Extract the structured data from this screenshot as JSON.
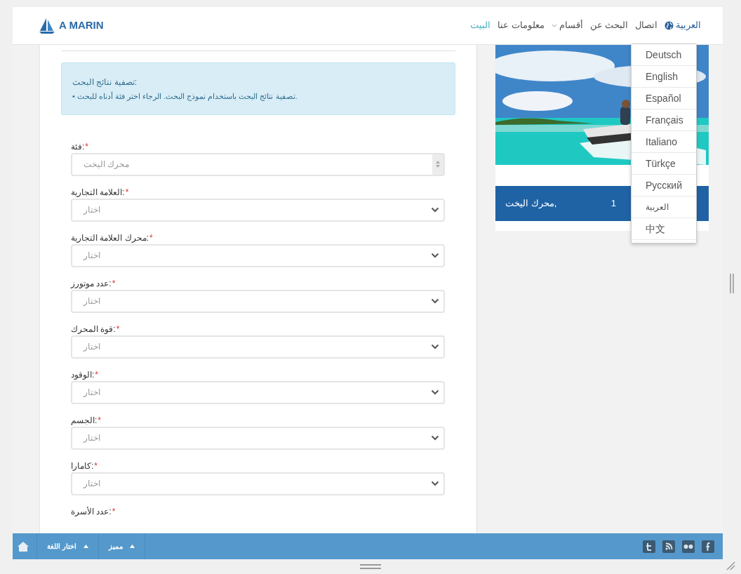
{
  "brand": {
    "name": "A MARIN"
  },
  "nav": [
    {
      "label": "العربية",
      "selected": false,
      "kind": "language"
    },
    {
      "label": "اتصال",
      "selected": false,
      "kind": "link"
    },
    {
      "label": "البحث عن",
      "selected": false,
      "kind": "link"
    },
    {
      "label": "أقسام",
      "selected": false,
      "kind": "dropdown"
    },
    {
      "label": "معلومات عنا",
      "selected": false,
      "kind": "link"
    },
    {
      "label": "البيت",
      "selected": true,
      "kind": "link"
    }
  ],
  "language_menu": [
    "Deutsch",
    "English",
    "Español",
    "Français",
    "Italiano",
    "Türkçe",
    "Русский",
    "العربية",
    "中文"
  ],
  "info": {
    "title": "تصفية نتائج البحث:",
    "items": [
      "• تصفية نتائج البحث باستخدام نموذج البحث. الرجاء اختر فئة أدناه للبحث."
    ]
  },
  "fields": [
    {
      "label": "فئة:",
      "mark": "*",
      "kind": "locked",
      "value": "محرك اليخت"
    },
    {
      "label": "العلامة التجارية:",
      "mark": "*",
      "kind": "select",
      "placeholder": "اختار"
    },
    {
      "label": "محرك العلامة التجارية:",
      "mark": "*",
      "kind": "select",
      "placeholder": "اختار"
    },
    {
      "label": "عدد موتورز:",
      "mark": "*",
      "kind": "select",
      "placeholder": "اختار"
    },
    {
      "label": "قوة المحرك:",
      "mark": "*",
      "kind": "select",
      "placeholder": "اختار"
    },
    {
      "label": "الوقود:",
      "mark": "*",
      "kind": "select",
      "placeholder": "اختار"
    },
    {
      "label": "الجسم:",
      "mark": "*",
      "kind": "select",
      "placeholder": "اختار"
    },
    {
      "label": "كامارا:",
      "mark": "*",
      "kind": "select",
      "placeholder": "اختار"
    },
    {
      "label": "عدد الأسرة:",
      "mark": "*",
      "kind": "label_only"
    }
  ],
  "card": {
    "caption": "محرك اليخت,",
    "count": "1"
  },
  "footer": {
    "menus": [
      "مميز",
      "اختار اللغة"
    ]
  }
}
